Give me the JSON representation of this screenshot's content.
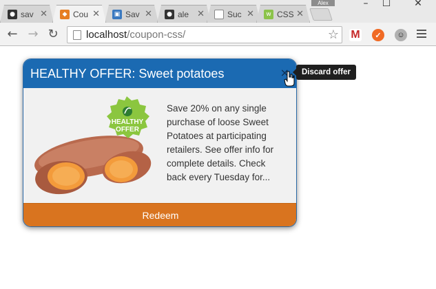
{
  "browser": {
    "profile_name": "Alex",
    "tabs": [
      {
        "title": "sav",
        "icon": "github-icon",
        "color": "#333333"
      },
      {
        "title": "Cou",
        "icon": "codepen-icon",
        "color": "#e67e22"
      },
      {
        "title": "Sav",
        "icon": "puzzle-icon",
        "color": "#3a79c0"
      },
      {
        "title": "ale",
        "icon": "github-icon",
        "color": "#333333"
      },
      {
        "title": "Suc",
        "icon": "page-icon",
        "color": "#888888"
      },
      {
        "title": "CSS",
        "icon": "w3-icon",
        "color": "#8bc34a"
      }
    ],
    "url_host": "localhost",
    "url_path": "/coupon-css/"
  },
  "coupon": {
    "title": "HEALTHY OFFER: Sweet potatoes",
    "badge_line1": "HEALTHY",
    "badge_line2": "OFFER",
    "description": "Save 20% on any single purchase of loose Sweet Potatoes at participating retailers. See offer info for complete details. Check back every Tuesday for...",
    "redeem_label": "Redeem",
    "close_label": "×",
    "tooltip": "Discard offer"
  },
  "colors": {
    "header": "#1b6ab2",
    "redeem": "#d9741f",
    "badge": "#8bc63f"
  }
}
